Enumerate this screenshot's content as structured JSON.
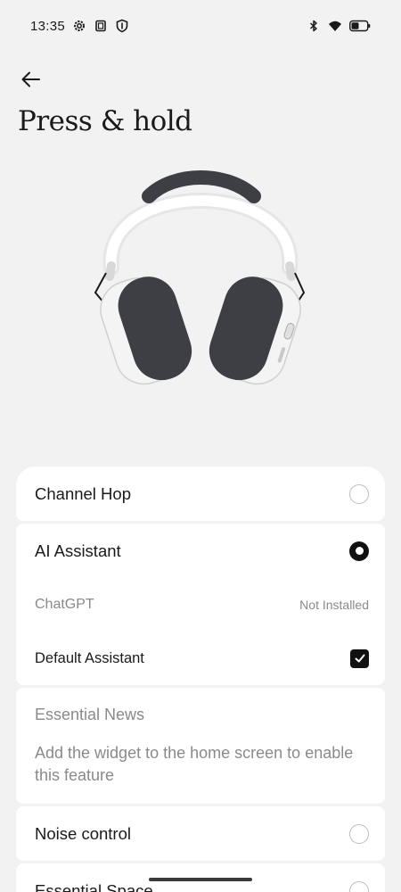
{
  "status_bar": {
    "time": "13:35",
    "left_icons": [
      "gear-icon",
      "screenshot-icon",
      "shield-icon"
    ],
    "right_icons": [
      "bluetooth-icon",
      "wifi-icon",
      "battery-icon"
    ]
  },
  "header": {
    "back_icon": "arrow-left-icon",
    "title": "Press & hold"
  },
  "product": {
    "image": "headphones-image"
  },
  "options": {
    "channel_hop": {
      "label": "Channel Hop",
      "selected": false
    },
    "ai_assistant": {
      "label": "AI Assistant",
      "selected": true,
      "chatgpt": {
        "label": "ChatGPT",
        "value": "Not Installed"
      },
      "default_assistant": {
        "label": "Default Assistant",
        "checked": true
      }
    },
    "essential_news": {
      "label": "Essential News",
      "description": "Add the widget to the home screen to enable this feature"
    },
    "noise_control": {
      "label": "Noise control",
      "selected": false
    },
    "essential_space": {
      "label": "Essential Space",
      "selected": false
    }
  },
  "colors": {
    "background": "#f2f2f2",
    "card": "#ffffff",
    "accent": "#111111",
    "muted_text": "#8a8a8a"
  }
}
